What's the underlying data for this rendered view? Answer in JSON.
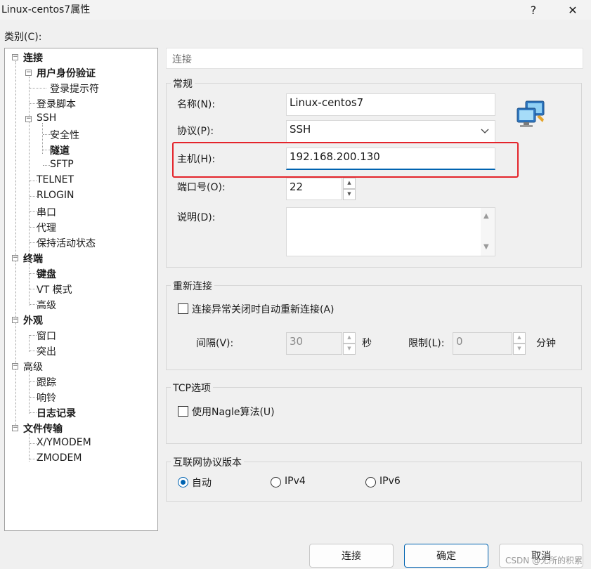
{
  "window": {
    "title": "Linux-centos7属性",
    "help_glyph": "?",
    "close_glyph": "✕"
  },
  "category_label": "类别(C):",
  "tree": {
    "connection": "连接",
    "user_auth": "用户身份验证",
    "login_prompt": "登录提示符",
    "login_script": "登录脚本",
    "ssh": "SSH",
    "security": "安全性",
    "tunnel": "隧道",
    "sftp": "SFTP",
    "telnet": "TELNET",
    "rlogin": "RLOGIN",
    "serial": "串口",
    "proxy": "代理",
    "keepalive": "保持活动状态",
    "terminal": "终端",
    "keyboard": "键盘",
    "vt_mode": "VT 模式",
    "term_advanced": "高级",
    "appearance": "外观",
    "window": "窗口",
    "highlight": "突出",
    "advanced": "高级",
    "trace": "跟踪",
    "bell": "响铃",
    "logging": "日志记录",
    "file_transfer": "文件传输",
    "xymodem": "X/YMODEM",
    "zmodem": "ZMODEM"
  },
  "header_title": "连接",
  "general": {
    "title": "常规",
    "name_label": "名称(N):",
    "name_value": "Linux-centos7",
    "protocol_label": "协议(P):",
    "protocol_value": "SSH",
    "host_label": "主机(H):",
    "host_value": "192.168.200.130",
    "port_label": "端口号(O):",
    "port_value": "22",
    "desc_label": "说明(D):",
    "desc_value": ""
  },
  "reconnect": {
    "title": "重新连接",
    "auto_label": "连接异常关闭时自动重新连接(A)",
    "auto_checked": false,
    "interval_label": "间隔(V):",
    "interval_value": "30",
    "interval_unit": "秒",
    "limit_label": "限制(L):",
    "limit_value": "0",
    "limit_unit": "分钟"
  },
  "tcp": {
    "title": "TCP选项",
    "nagle_label": "使用Nagle算法(U)",
    "nagle_checked": false
  },
  "ip_version": {
    "title": "互联网协议版本",
    "auto": "自动",
    "ipv4": "IPv4",
    "ipv6": "IPv6",
    "selected": "auto"
  },
  "buttons": {
    "connect": "连接",
    "ok": "确定",
    "cancel": "取消"
  },
  "watermark": "CSDN @无所的积累",
  "colors": {
    "accent": "#0063b1",
    "highlight_box": "#e4242b"
  }
}
